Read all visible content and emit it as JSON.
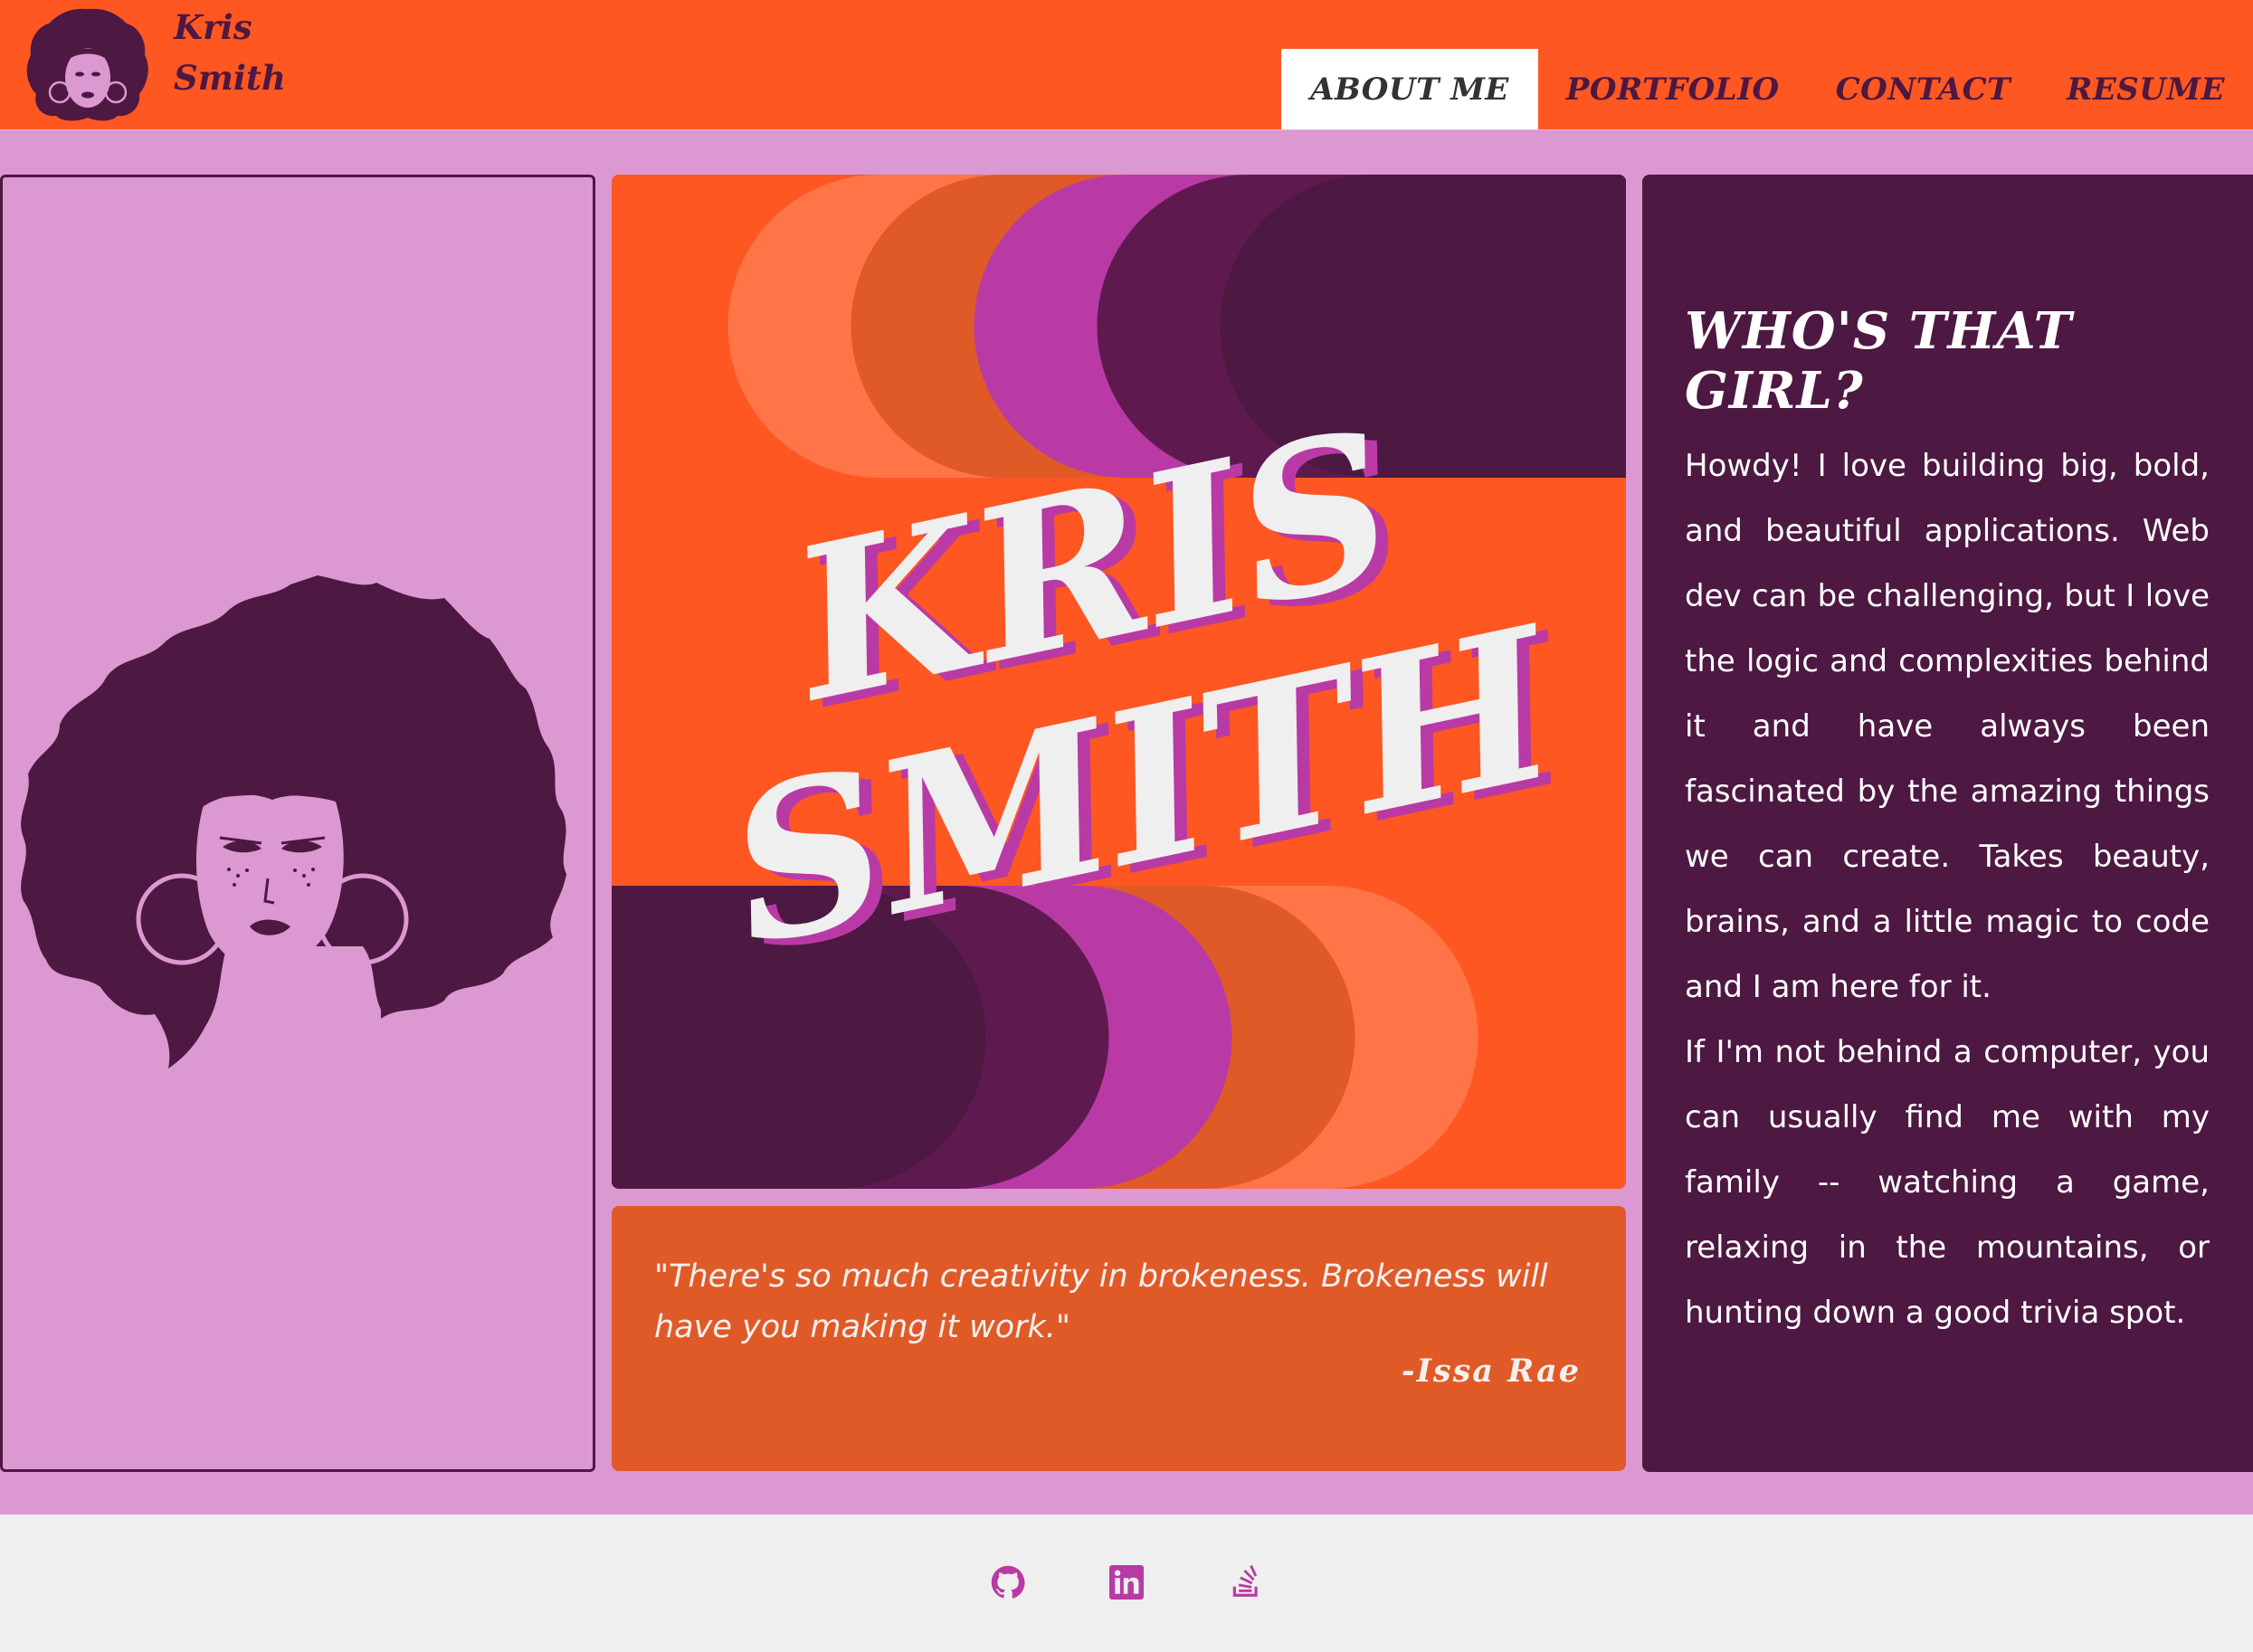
{
  "brand": {
    "first_name": "Kris",
    "last_name": "Smith"
  },
  "nav": {
    "items": [
      {
        "label": "ABOUT ME",
        "active": true
      },
      {
        "label": "PORTFOLIO",
        "active": false
      },
      {
        "label": "CONTACT",
        "active": false
      },
      {
        "label": "RESUME",
        "active": false
      }
    ]
  },
  "hero": {
    "line1": "KRIS",
    "line2": "SMITH"
  },
  "quote": {
    "text": "\"There's so much creativity in brokeness. Brokeness will have you making it work.\"",
    "author": "-Issa Rae"
  },
  "about": {
    "title": "WHO'S THAT GIRL?",
    "paragraph1": "Howdy! I love building big, bold, and beautiful applications. Web dev can be challenging, but I love the logic and complexities behind it and have always been fascinated by the amazing things we can create. Takes beauty, brains, and a little magic to code and I am here for it.",
    "paragraph2": "If I'm not behind a computer, you can usually find me with my family -- watching a game, relaxing in the mountains, or hunting down a good trivia spot."
  },
  "footer": {
    "icons": [
      "github-icon",
      "linkedin-icon",
      "stack-overflow-icon"
    ]
  },
  "colors": {
    "orange": "#ff5722",
    "plum": "#4d1842",
    "pink": "#dc98d0",
    "magenta": "#b93aa5",
    "burnt_orange": "#e05a28",
    "coral": "#ff7547",
    "footer_bg": "#efefef"
  }
}
